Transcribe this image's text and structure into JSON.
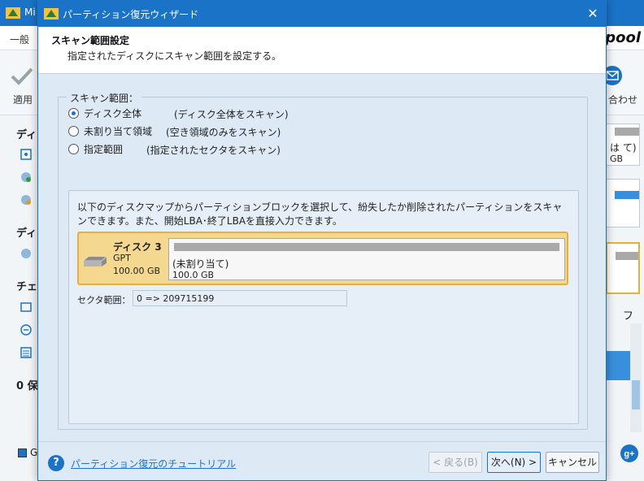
{
  "background_app": {
    "title": "Mi",
    "menu_first_item": "一般",
    "logo_fragment": "pool",
    "toolbar_apply": "適用",
    "toolbar_contact": "合わせ",
    "sidebar_heads": [
      "ディ",
      "ディ",
      "チェ",
      "0 保"
    ],
    "right_panel_lines": [
      "は て)",
      "GB"
    ],
    "right_scroll_char": "フ",
    "status_square_label": "G"
  },
  "dialog": {
    "title": "パーティション復元ウィザード",
    "header": {
      "title": "スキャン範囲設定",
      "subtitle": "指定されたディスクにスキャン範囲を設定する。"
    },
    "scan_range": {
      "legend": "スキャン範囲：",
      "options": [
        {
          "label": "ディスク全体",
          "desc": "(ディスク全体をスキャン)",
          "checked": true
        },
        {
          "label": "未割り当て領域",
          "desc": "(空き領域のみをスキャン)",
          "checked": false
        },
        {
          "label": "指定範囲",
          "desc": "(指定されたセクタをスキャン)",
          "checked": false
        }
      ]
    },
    "disk_map": {
      "description": "以下のディスクマップからパーティションブロックを選択して、紛失したか削除されたパーティションをスキャンできます。また、開始LBA･終了LBAを直接入力できます。",
      "disk": {
        "name": "ディスク 3",
        "type": "GPT",
        "size": "100.00 GB",
        "partition": {
          "label": "(未割り当て)",
          "size": "100.0 GB"
        }
      },
      "sector_label": "セクタ範囲：",
      "sector_value": "0 => 209715199"
    },
    "footer": {
      "help_link": "パーティション復元のチュートリアル",
      "back": "< 戻る(B)",
      "next": "次へ(N) >",
      "cancel": "キャンセル"
    }
  },
  "colors": {
    "accent": "#1a73c6",
    "selected_disk": "#f5d890",
    "selected_disk_border": "#e3b23c"
  }
}
